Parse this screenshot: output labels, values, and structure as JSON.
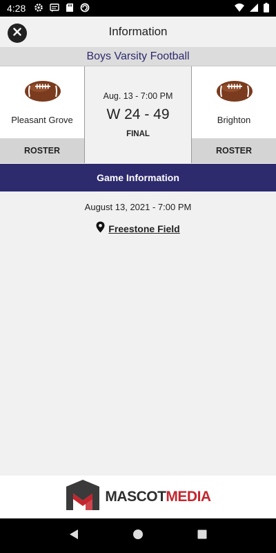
{
  "status_bar": {
    "time": "4:28",
    "icons": [
      "gear-icon",
      "message-icon",
      "sd-card-icon",
      "sync-icon",
      "wifi-icon",
      "signal-icon",
      "battery-icon"
    ]
  },
  "header": {
    "title": "Information",
    "close_icon": "close-icon"
  },
  "sport": "Boys Varsity Football",
  "game": {
    "home_team": {
      "name": "Pleasant Grove",
      "roster_label": "ROSTER",
      "icon": "football-icon"
    },
    "away_team": {
      "name": "Brighton",
      "roster_label": "ROSTER",
      "icon": "football-icon"
    },
    "datetime_short": "Aug. 13 - 7:00 PM",
    "score": "W 24 - 49",
    "status": "FINAL"
  },
  "game_information": {
    "section_title": "Game Information",
    "date_full": "August 13, 2021 - 7:00 PM",
    "location": "Freestone Field",
    "location_icon": "map-pin-icon"
  },
  "footer": {
    "brand_part1": "MASCOT",
    "brand_part2": "MEDIA",
    "logo_icon": "mascot-media-logo-icon"
  },
  "colors": {
    "accent": "#2d2a6e",
    "brand_red": "#c4262e",
    "background": "#f1f1f1"
  },
  "nav_bar": {
    "icons": [
      "back-icon",
      "home-icon",
      "recents-icon"
    ]
  }
}
